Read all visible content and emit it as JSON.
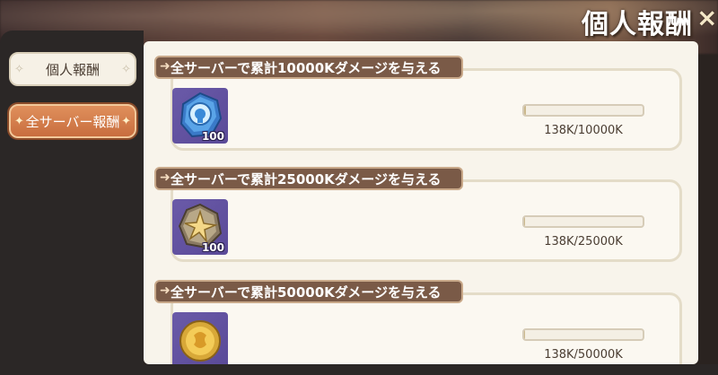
{
  "header": {
    "title": "個人報酬",
    "close_icon": "×"
  },
  "tabs": [
    {
      "label": "個人報酬",
      "active": false
    },
    {
      "label": "全サーバー報酬",
      "active": true
    }
  ],
  "missions": [
    {
      "label": "全サーバーで累計10000Kダメージを与える",
      "reward_icon": "blue-crystal-icon",
      "reward_qty": "100",
      "progress_text": "138K/10000K",
      "progress": 0.0138
    },
    {
      "label": "全サーバーで累計25000Kダメージを与える",
      "reward_icon": "star-stone-icon",
      "reward_qty": "100",
      "progress_text": "138K/25000K",
      "progress": 0.0055
    },
    {
      "label": "全サーバーで累計50000Kダメージを与える",
      "reward_icon": "gold-coin-icon",
      "reward_qty": "",
      "progress_text": "138K/50000K",
      "progress": 0.0028
    }
  ],
  "colors": {
    "label_bg": "#7a5a47",
    "active_tab": "#d47e4a",
    "panel_bg": "#f8f4eb"
  }
}
